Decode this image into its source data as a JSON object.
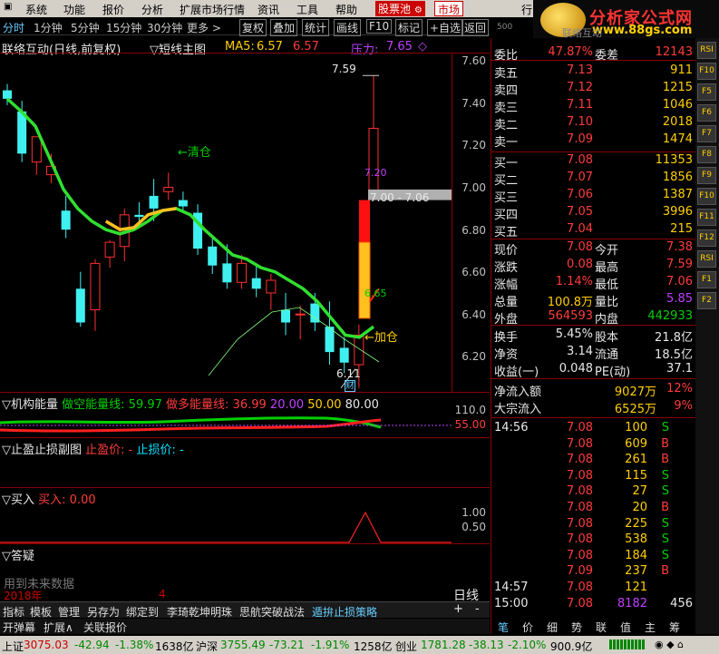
{
  "menu": {
    "items": [
      "系统",
      "功能",
      "报价",
      "分析",
      "扩展市场行情",
      "资讯",
      "工具",
      "帮助"
    ],
    "stock_pool": "股票池",
    "market": "市场",
    "trade_cut": "行"
  },
  "logo": {
    "text": "分析家公式网",
    "url": "www.88gs.com",
    "sub": "联络互动"
  },
  "toolbar": {
    "periods": [
      "分时",
      "1分钟",
      "5分钟",
      "15分钟",
      "30分钟",
      "更多 >"
    ],
    "buttons": [
      "复权",
      "叠加",
      "统计",
      "画线",
      "F10",
      "标记",
      "+自选",
      "返回"
    ],
    "page_num": "500"
  },
  "chart_title": {
    "name": "联络互动(日线,前复权)",
    "indicator": "▽短线主图",
    "ma_label": "MA5:",
    "ma_value": "6.57",
    "ma_value2": "6.57",
    "pressure_label": "压力:",
    "pressure_value": "7.65",
    "diamond": "◇"
  },
  "annotations": {
    "high": "7.59",
    "low": "6.11",
    "range": "7.00 - 7.06",
    "clear": "←清仓",
    "add": "←加仓",
    "level_720": "7.20",
    "level_665": "6.65",
    "cai": "财",
    "year": "2018年",
    "month": "4"
  },
  "chart_data": {
    "type": "candlestick",
    "y_ticks": [
      "7.60",
      "7.40",
      "7.20",
      "7.00",
      "6.80",
      "6.60",
      "6.40",
      "6.20"
    ],
    "ylim": [
      6.13,
      7.66
    ]
  },
  "indicators": {
    "ind1": {
      "title": "▽机构能量",
      "l1": "做空能量线:",
      "v1": "59.97",
      "l2": "做多能量线:",
      "v2": "36.99",
      "v3": "20.00",
      "v4": "50.00",
      "v5": "80.00",
      "ticks": [
        "110.0",
        "55.00"
      ]
    },
    "ind2": {
      "title": "▽止盈止损副图",
      "l1": "止盈价:",
      "v1": "-",
      "l2": "止损价:",
      "v2": "-"
    },
    "ind3": {
      "title": "▽买入",
      "l1": "买入:",
      "v1": "0.00",
      "ticks": [
        "1.00",
        "0.50"
      ]
    },
    "ind4": {
      "title": "▽答疑",
      "note": "用到未来数据"
    }
  },
  "bottom_tabs": [
    "指标",
    "模板",
    "管理",
    "另存为",
    "绑定到",
    "李琦乾坤明珠",
    "思航突破战法",
    "遁拚止损策略"
  ],
  "bottom_right": {
    "period": "日线",
    "plus": "+",
    "minus": "-"
  },
  "tabs2": [
    "开弹幕",
    "扩展∧",
    "关联报价"
  ],
  "quote": {
    "weibi": {
      "label": "委比",
      "value": "47.87%",
      "label2": "委差",
      "value2": "12143"
    },
    "asks": [
      {
        "label": "卖五",
        "price": "7.13",
        "vol": "911"
      },
      {
        "label": "卖四",
        "price": "7.12",
        "vol": "1215"
      },
      {
        "label": "卖三",
        "price": "7.11",
        "vol": "1046"
      },
      {
        "label": "卖二",
        "price": "7.10",
        "vol": "2018"
      },
      {
        "label": "卖一",
        "price": "7.09",
        "vol": "1474"
      }
    ],
    "bids": [
      {
        "label": "买一",
        "price": "7.08",
        "vol": "11353"
      },
      {
        "label": "买二",
        "price": "7.07",
        "vol": "1856"
      },
      {
        "label": "买三",
        "price": "7.06",
        "vol": "1387"
      },
      {
        "label": "买四",
        "price": "7.05",
        "vol": "3996"
      },
      {
        "label": "买五",
        "price": "7.04",
        "vol": "215"
      }
    ],
    "stats": [
      {
        "l1": "现价",
        "v1": "7.08",
        "c1": "red",
        "l2": "今开",
        "v2": "7.38",
        "c2": "red"
      },
      {
        "l1": "涨跌",
        "v1": "0.08",
        "c1": "red",
        "l2": "最高",
        "v2": "7.59",
        "c2": "red"
      },
      {
        "l1": "涨幅",
        "v1": "1.14%",
        "c1": "red",
        "l2": "最低",
        "v2": "7.06",
        "c2": "red"
      },
      {
        "l1": "总量",
        "v1": "100.8万",
        "c1": "yellow",
        "l2": "量比",
        "v2": "5.85",
        "c2": "purple"
      },
      {
        "l1": "外盘",
        "v1": "564593",
        "c1": "red",
        "l2": "内盘",
        "v2": "442933",
        "c2": "green"
      }
    ],
    "stats2": [
      {
        "l1": "换手",
        "v1": "5.45%",
        "l2": "股本",
        "v2": "21.8亿"
      },
      {
        "l1": "净资",
        "v1": "3.14",
        "l2": "流通",
        "v2": "18.5亿"
      },
      {
        "l1": "收益(一)",
        "v1": "0.048",
        "l2": "PE(动)",
        "v2": "37.1"
      }
    ],
    "flows": [
      {
        "label": "净流入额",
        "value": "9027万",
        "pct": "12%"
      },
      {
        "label": "大宗流入",
        "value": "6525万",
        "pct": "9%"
      }
    ],
    "ticks": [
      {
        "time": "14:56",
        "price": "7.08",
        "vol": "100",
        "bs": "S"
      },
      {
        "time": "",
        "price": "7.08",
        "vol": "609",
        "bs": "B"
      },
      {
        "time": "",
        "price": "7.08",
        "vol": "261",
        "bs": "B"
      },
      {
        "time": "",
        "price": "7.08",
        "vol": "115",
        "bs": "S"
      },
      {
        "time": "",
        "price": "7.08",
        "vol": "27",
        "bs": "S"
      },
      {
        "time": "",
        "price": "7.08",
        "vol": "20",
        "bs": "B"
      },
      {
        "time": "",
        "price": "7.08",
        "vol": "225",
        "bs": "S"
      },
      {
        "time": "",
        "price": "7.08",
        "vol": "538",
        "bs": "S"
      },
      {
        "time": "",
        "price": "7.08",
        "vol": "184",
        "bs": "S"
      },
      {
        "time": "",
        "price": "7.09",
        "vol": "237",
        "bs": "B"
      },
      {
        "time": "14:57",
        "price": "7.08",
        "vol": "121",
        "bs": ""
      },
      {
        "time": "15:00",
        "price": "7.08",
        "vol": "8182",
        "bs": "",
        "extra": "456"
      }
    ],
    "tabs": [
      "笔",
      "价",
      "细",
      "势",
      "联",
      "值",
      "主",
      "筹"
    ]
  },
  "sidebar": [
    "RSI",
    "F10",
    "F5",
    "F6",
    "F7",
    "F8",
    "F9",
    "F10",
    "F11",
    "F12",
    "RSI",
    "F1",
    "F2"
  ],
  "status": {
    "sh_label": "上证",
    "sh_val": "3075.03",
    "sh_chg": "-42.94",
    "sh_pct": "-1.38%",
    "sh_amt": "1638亿",
    "sz_label": "沪深",
    "sz_val": "3755.49",
    "sz_chg": "-73.21",
    "sz_pct": "-1.91%",
    "sz_amt": "1258亿",
    "cy_label": "创业",
    "cy_val": "1781.28",
    "cy_chg": "-38.13",
    "cy_pct": "-2.10%",
    "cy_amt": "900.9亿"
  }
}
